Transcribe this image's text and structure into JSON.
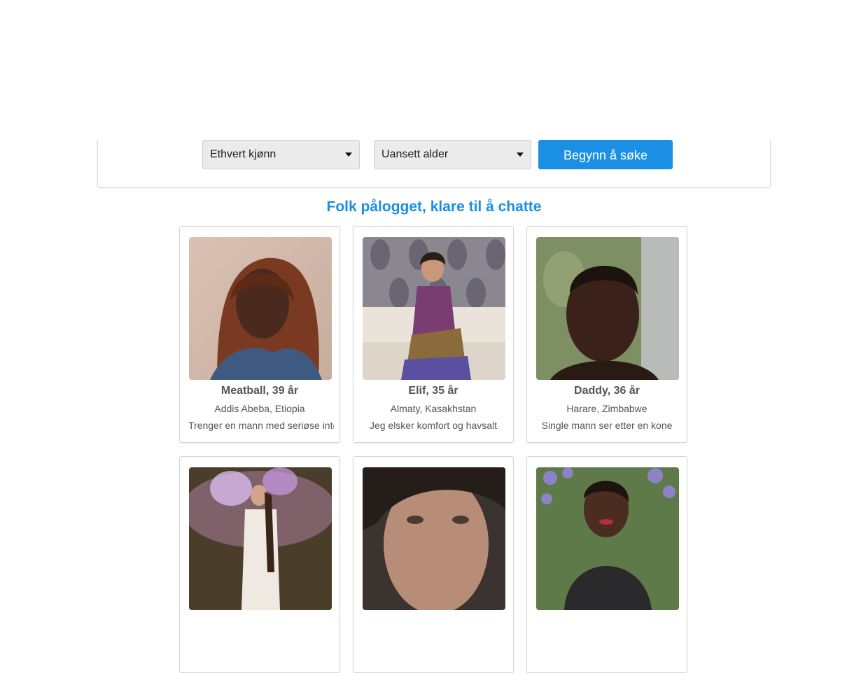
{
  "search": {
    "gender_selected": "Ethvert kjønn",
    "age_selected": "Uansett alder",
    "button_label": "Begynn å søke"
  },
  "online_heading": "Folk pålogget, klare til å chatte",
  "profiles": [
    {
      "name": "Meatball, 39 år",
      "location": "Addis Abeba, Etiopia",
      "tagline": "Trenger en mann med seriøse intentioner"
    },
    {
      "name": "Elif, 35 år",
      "location": "Almaty, Kasakhstan",
      "tagline": "Jeg elsker komfort og havsalt"
    },
    {
      "name": "Daddy, 36 år",
      "location": "Harare, Zimbabwe",
      "tagline": "Single mann ser etter en kone"
    }
  ],
  "icons": {
    "dropdown": "chevron-down-icon"
  },
  "colors": {
    "accent": "#1a8fe3",
    "select_bg": "#ebebeb"
  }
}
